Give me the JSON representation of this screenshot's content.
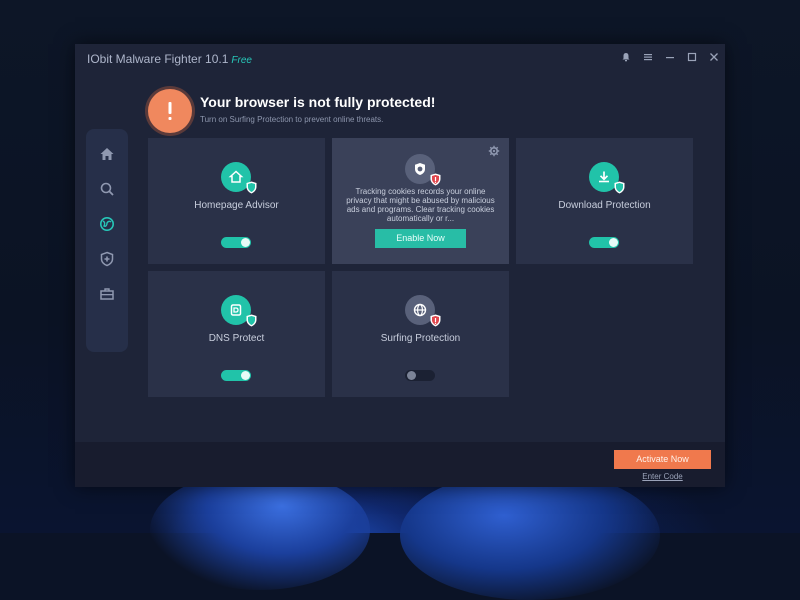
{
  "window": {
    "app_name": "IObit Malware Fighter 10.1",
    "edition": "Free"
  },
  "window_controls": [
    {
      "icon": "bell-icon"
    },
    {
      "icon": "menu-icon"
    },
    {
      "icon": "minimize-icon"
    },
    {
      "icon": "maximize-icon"
    },
    {
      "icon": "close-icon"
    }
  ],
  "sidebar": {
    "items": [
      {
        "icon": "home-icon"
      },
      {
        "icon": "search-icon"
      },
      {
        "icon": "globe-icon",
        "active": true
      },
      {
        "icon": "shield-plus-icon"
      },
      {
        "icon": "toolbox-icon"
      }
    ]
  },
  "alert": {
    "icon": "exclamation-icon",
    "title": "Your browser is not fully protected!",
    "subtitle": "Turn on Surfing Protection to prevent online threats."
  },
  "cards": [
    {
      "label": "Homepage Advisor",
      "icon": "home-shield-icon",
      "toggle_on": true
    },
    {
      "description": "Tracking cookies records your online privacy that might be abused by malicious ads and programs. Clear tracking cookies automatically or r...",
      "button": "Enable Now",
      "icon": "cookie-shield-icon"
    },
    {
      "label": "Download Protection",
      "icon": "download-shield-icon",
      "toggle_on": true
    },
    {
      "label": "DNS Protect",
      "icon": "dns-shield-icon",
      "toggle_on": true
    },
    {
      "label": "Surfing Protection",
      "icon": "globe-shield-icon",
      "toggle_on": false
    }
  ],
  "footer": {
    "activate_label": "Activate Now",
    "enter_code_label": "Enter Code"
  },
  "colors": {
    "accent": "#21c3a9",
    "warning": "#f0885e",
    "activate": "#f0794d",
    "window_bg": "#1e2438",
    "card_bg": "#2a3148"
  }
}
